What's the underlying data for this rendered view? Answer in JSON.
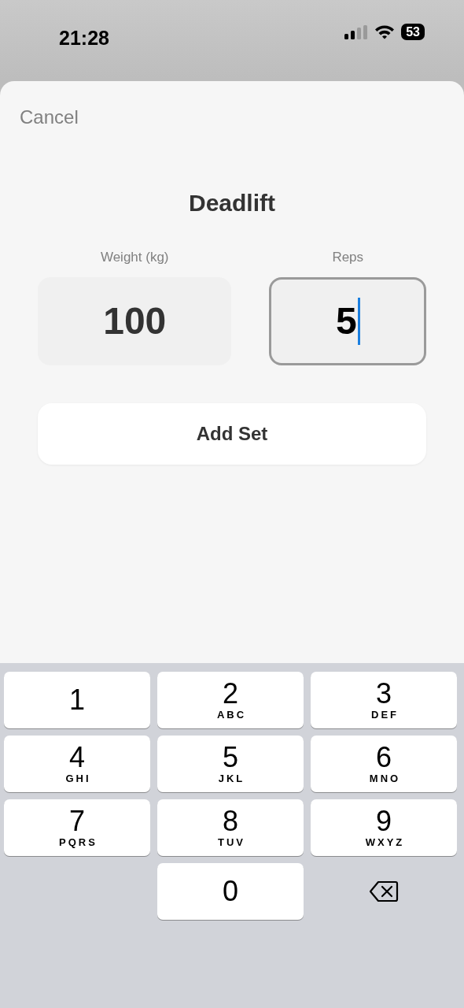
{
  "status_bar": {
    "time": "21:28",
    "battery": "53"
  },
  "sheet": {
    "cancel": "Cancel",
    "title": "Deadlift",
    "fields": [
      {
        "label": "Weight (kg)",
        "value": "100",
        "focused": false
      },
      {
        "label": "Reps",
        "value": "5",
        "focused": true
      }
    ],
    "button": "Add Set"
  },
  "keyboard": {
    "keys": [
      {
        "kind": "digit",
        "digit": "1"
      },
      {
        "kind": "digit",
        "digit": "2",
        "letters": "ABC"
      },
      {
        "kind": "digit",
        "digit": "3",
        "letters": "DEF"
      },
      {
        "kind": "digit",
        "digit": "4",
        "letters": "GHI"
      },
      {
        "kind": "digit",
        "digit": "5",
        "letters": "JKL"
      },
      {
        "kind": "digit",
        "digit": "6",
        "letters": "MNO"
      },
      {
        "kind": "digit",
        "digit": "7",
        "letters": "PQRS"
      },
      {
        "kind": "digit",
        "digit": "8",
        "letters": "TUV"
      },
      {
        "kind": "digit",
        "digit": "9",
        "letters": "WXYZ"
      },
      {
        "kind": "digit",
        "digit": "0"
      },
      {
        "kind": "delete"
      }
    ]
  }
}
